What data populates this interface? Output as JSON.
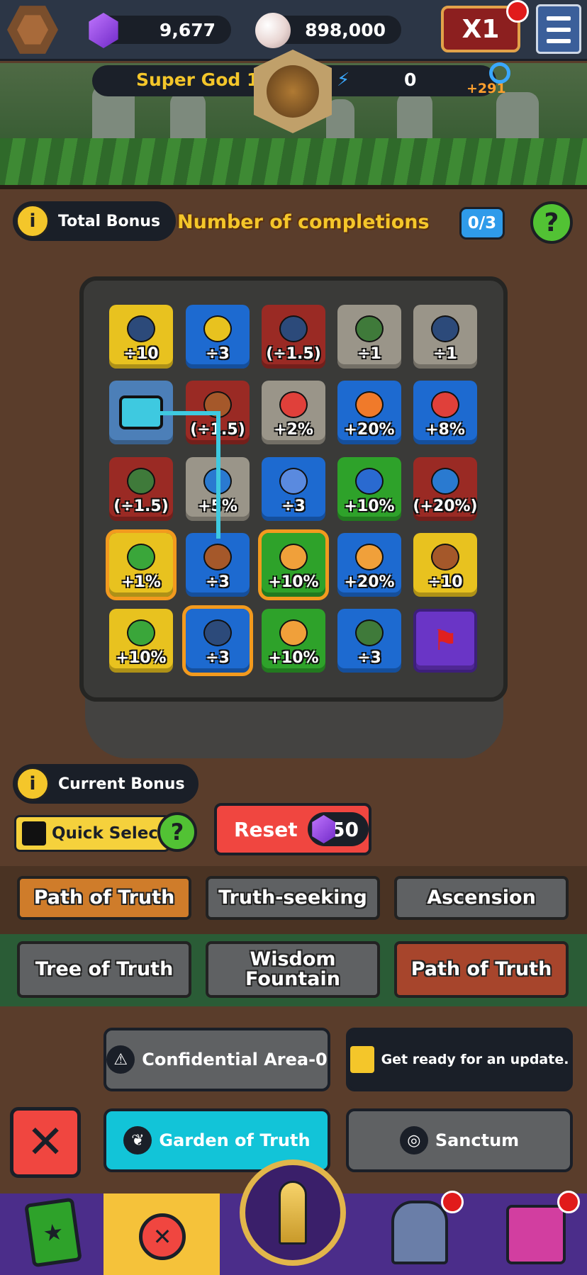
{
  "header": {
    "gems": "9,677",
    "pearls": "898,000",
    "speed_label": "X1",
    "rank_name": "Super God 1",
    "energy": "0",
    "energy_bonus": "+291"
  },
  "bonus": {
    "total_label": "Total Bonus",
    "completions_label": "Number of completions",
    "completions_count": "0/3",
    "help_glyph": "?",
    "info_glyph": "i"
  },
  "board": {
    "tiles": [
      [
        "÷10",
        "÷3",
        "(÷1.5)",
        "÷1",
        "÷1"
      ],
      [
        "",
        "(÷1.5)",
        "+2%",
        "+20%",
        "+8%"
      ],
      [
        "(÷1.5)",
        "+5%",
        "÷3",
        "+10%",
        "(+20%)"
      ],
      [
        "+1%",
        "÷3",
        "+10%",
        "+20%",
        "÷10"
      ],
      [
        "+10%",
        "÷3",
        "+10%",
        "÷3",
        ""
      ]
    ]
  },
  "current": {
    "label": "Current Bonus",
    "quick_select": "Quick Select",
    "reset_label": "Reset",
    "reset_cost": "50"
  },
  "tabs_primary": [
    "Path of Truth",
    "Truth-seeking",
    "Ascension"
  ],
  "tabs_secondary": [
    "Tree of Truth",
    "Wisdom Fountain",
    "Path of Truth"
  ],
  "zones": {
    "confidential": "Confidential Area-0",
    "update": "Get ready for an update.",
    "garden": "Garden of Truth",
    "sanctum": "Sanctum"
  },
  "colors": {
    "accent_yellow": "#f4c62a",
    "reset_red": "#f04640",
    "garden_cyan": "#12c4d8",
    "completion_blue": "#2f9bea"
  }
}
